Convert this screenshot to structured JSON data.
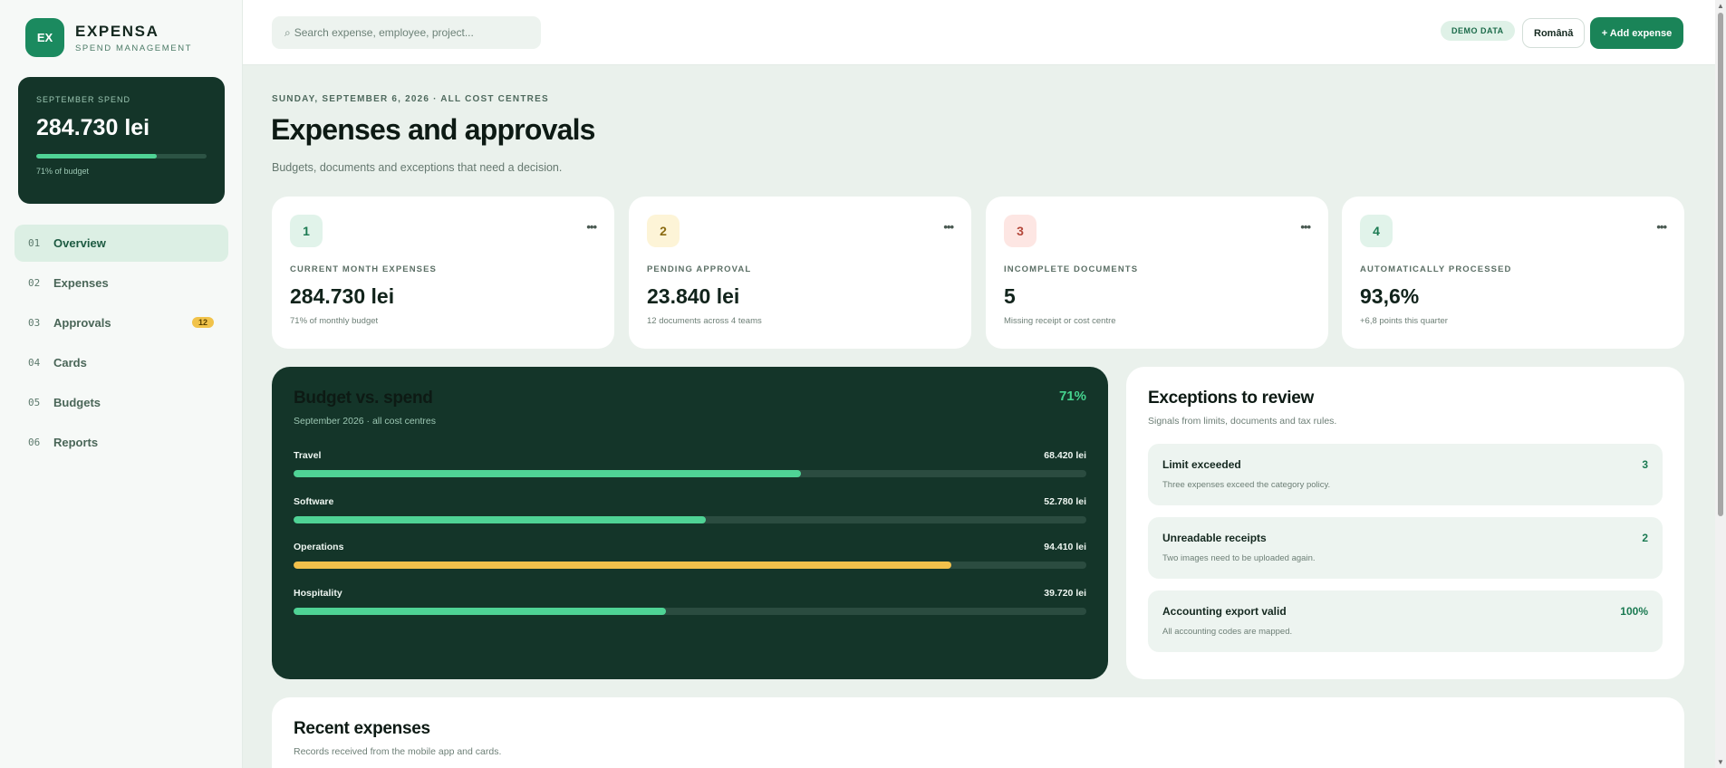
{
  "brand": {
    "logo_text": "EX",
    "name": "EXPENSA",
    "tagline": "SPEND MANAGEMENT"
  },
  "spend_card": {
    "label": "SEPTEMBER SPEND",
    "value": "284.730 lei",
    "progress_percent": 71,
    "note": "71% of budget"
  },
  "nav": {
    "items": [
      {
        "num": "01",
        "label": "Overview",
        "active": true,
        "badge": ""
      },
      {
        "num": "02",
        "label": "Expenses",
        "active": false,
        "badge": ""
      },
      {
        "num": "03",
        "label": "Approvals",
        "active": false,
        "badge": "12"
      },
      {
        "num": "04",
        "label": "Cards",
        "active": false,
        "badge": ""
      },
      {
        "num": "05",
        "label": "Budgets",
        "active": false,
        "badge": ""
      },
      {
        "num": "06",
        "label": "Reports",
        "active": false,
        "badge": ""
      }
    ]
  },
  "topbar": {
    "search_icon": "⌕",
    "search_placeholder": "Search expense, employee, project...",
    "demo_badge": "DEMO DATA",
    "language_label": "Română",
    "add_label": "+ Add expense"
  },
  "header": {
    "eyebrow": "SUNDAY, SEPTEMBER 6, 2026 · ALL COST CENTRES",
    "title": "Expenses and approvals",
    "subtitle": "Budgets, documents and exceptions that need a decision."
  },
  "stats": [
    {
      "num": "1",
      "label": "CURRENT MONTH EXPENSES",
      "value": "284.730 lei",
      "note": "71% of monthly budget",
      "badge_bg": "#e1f3ea",
      "badge_fg": "#1b7a52"
    },
    {
      "num": "2",
      "label": "PENDING APPROVAL",
      "value": "23.840 lei",
      "note": "12 documents across 4 teams",
      "badge_bg": "#fdf4d7",
      "badge_fg": "#8a6a10"
    },
    {
      "num": "3",
      "label": "INCOMPLETE DOCUMENTS",
      "value": "5",
      "note": "Missing receipt or cost centre",
      "badge_bg": "#fde6e3",
      "badge_fg": "#b3473a"
    },
    {
      "num": "4",
      "label": "AUTOMATICALLY PROCESSED",
      "value": "93,6%",
      "note": "+6,8 points this quarter",
      "badge_bg": "#e1f3ea",
      "badge_fg": "#1b7a52"
    }
  ],
  "stat_more_label": "•••",
  "budget": {
    "title": "Budget vs. spend",
    "subtitle": "September 2026 · all cost centres",
    "percent_label": "71%",
    "rows": [
      {
        "label": "Travel",
        "amount": "68.420 lei",
        "fill_percent": 64,
        "color": "#4fd395"
      },
      {
        "label": "Software",
        "amount": "52.780 lei",
        "fill_percent": 52,
        "color": "#4fd395"
      },
      {
        "label": "Operations",
        "amount": "94.410 lei",
        "fill_percent": 83,
        "color": "#f2c14b"
      },
      {
        "label": "Hospitality",
        "amount": "39.720 lei",
        "fill_percent": 47,
        "color": "#4fd395"
      }
    ]
  },
  "exceptions": {
    "title": "Exceptions to review",
    "subtitle": "Signals from limits, documents and tax rules.",
    "items": [
      {
        "name": "Limit exceeded",
        "desc": "Three expenses exceed the category policy.",
        "count": "3"
      },
      {
        "name": "Unreadable receipts",
        "desc": "Two images need to be uploaded again.",
        "count": "2"
      },
      {
        "name": "Accounting export valid",
        "desc": "All accounting codes are mapped.",
        "count": "100%"
      }
    ]
  },
  "recent": {
    "title": "Recent expenses",
    "subtitle": "Records received from the mobile app and cards."
  },
  "scrollbar": {
    "up_arrow": "▲",
    "down_arrow": "▼"
  }
}
